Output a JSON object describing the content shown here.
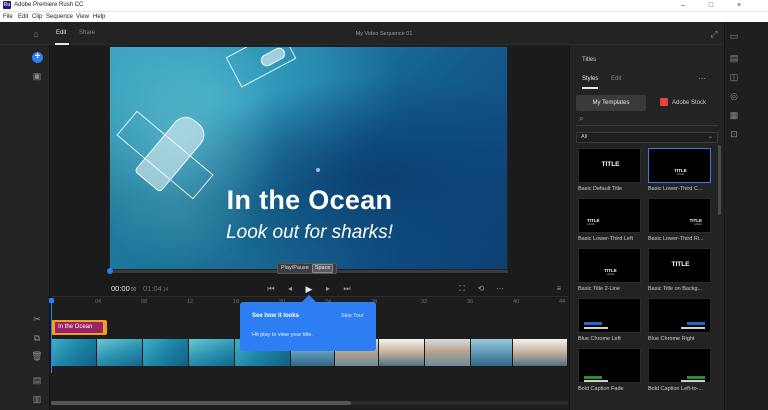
{
  "window": {
    "title": "Adobe Premiere Rush CC",
    "logo": "Ru",
    "controls": [
      "–",
      "□",
      "×"
    ]
  },
  "menu": [
    "File",
    "Edit",
    "Clip",
    "Sequence",
    "View",
    "Help"
  ],
  "appbar": {
    "tabs": [
      "Edit",
      "Share"
    ],
    "active_tab": "Edit",
    "project_title": "My Video Sequence 01"
  },
  "preview": {
    "title_line": "In the Ocean",
    "subtitle_line": "Look out for sharks!",
    "tooltip": {
      "label": "Play/Pause",
      "key": "Space"
    },
    "timecode_current": "00:00",
    "timecode_current_frames": "00",
    "timecode_total": "01:04",
    "timecode_total_frames": "14",
    "playhead_fraction": 0.0
  },
  "timeline": {
    "ruler": [
      "04",
      "08",
      "12",
      "16",
      "20",
      "24",
      "28",
      "32",
      "36",
      "40",
      "44"
    ],
    "title_clip_label": "In the Ocean",
    "scroll_fraction": 0.58
  },
  "tour": {
    "heading": "See how it looks",
    "skip": "Skip Tour",
    "body": "Hit play to view your title."
  },
  "panel": {
    "title": "Titles",
    "tabs": [
      "Styles",
      "Edit"
    ],
    "active_tab": "Styles",
    "source_tabs": [
      "My Templates",
      "Adobe Stock"
    ],
    "filter_value": "All",
    "templates": [
      {
        "label": "Basic Default Title",
        "thumb": "TITLE",
        "thumb_sub": ""
      },
      {
        "label": "Basic Lower-Third C...",
        "thumb": "TITLE",
        "thumb_sub": "subtitle",
        "selected": true
      },
      {
        "label": "Basic Lower-Third Left",
        "thumb": "TITLE",
        "thumb_sub": "subtitle"
      },
      {
        "label": "Basic Lower-Third Ri...",
        "thumb": "TITLE",
        "thumb_sub": "subtitle"
      },
      {
        "label": "Basic Title 2-Line",
        "thumb": "TITLE",
        "thumb_sub": "subtitle"
      },
      {
        "label": "Basic Title on Backg...",
        "thumb": "TITLE",
        "thumb_sub": ""
      },
      {
        "label": "Blue Chrome Left",
        "thumb": "",
        "thumb_sub": ""
      },
      {
        "label": "Blue Chrome Right",
        "thumb": "",
        "thumb_sub": ""
      },
      {
        "label": "Bold Caption Fade",
        "thumb": "",
        "thumb_sub": ""
      },
      {
        "label": "Bold Caption Left-to-...",
        "thumb": "",
        "thumb_sub": ""
      }
    ]
  },
  "colors": {
    "accent_blue": "#2c7ef2",
    "clip_orange": "#f0a11b",
    "title_clip_magenta": "#9b2268",
    "stock_red": "#e8423e"
  }
}
